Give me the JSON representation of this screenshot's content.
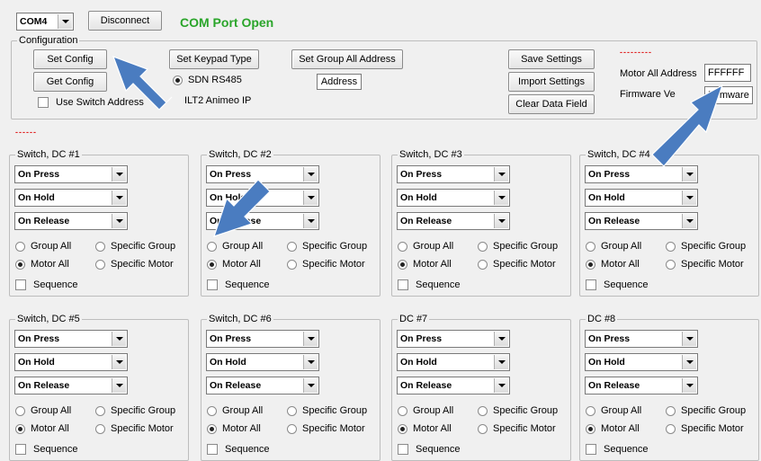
{
  "top": {
    "com_port": "COM4",
    "disconnect_label": "Disconnect",
    "status_text": "COM Port Open"
  },
  "config": {
    "title": "Configuration",
    "set_config_label": "Set Config",
    "get_config_label": "Get Config",
    "use_switch_address_label": "Use Switch Address",
    "set_keypad_type_label": "Set Keypad Type",
    "sdn_rs485_label": "SDN RS485",
    "ilt2_label": "ILT2  Animeo IP",
    "set_group_all_label": "Set Group All Address",
    "address_label": "Address",
    "save_settings_label": "Save Settings",
    "import_settings_label": "Import Settings",
    "clear_data_field_label": "Clear Data Field",
    "red_dashes": "---------",
    "motor_all_address_label": "Motor All Address",
    "motor_all_address_value": "FFFFFF",
    "firmware_version_label": "Firmware Ve",
    "firmware_value": "Firmware"
  },
  "status_dashes": "------",
  "panels": [
    {
      "title": "Switch, DC #1",
      "press": "On Press",
      "hold": "On Hold",
      "release": "On Release",
      "group_all": "Group All",
      "specific_group": "Specific Group",
      "motor_all": "Motor All",
      "specific_motor": "Specific Motor",
      "sequence": "Sequence"
    },
    {
      "title": "Switch, DC #2",
      "press": "On Press",
      "hold": "On Hold",
      "release": "On Release",
      "group_all": "Group All",
      "specific_group": "Specific Group",
      "motor_all": "Motor All",
      "specific_motor": "Specific Motor",
      "sequence": "Sequence"
    },
    {
      "title": "Switch, DC #3",
      "press": "On Press",
      "hold": "On Hold",
      "release": "On Release",
      "group_all": "Group All",
      "specific_group": "Specific Group",
      "motor_all": "Motor All",
      "specific_motor": "Specific Motor",
      "sequence": "Sequence"
    },
    {
      "title": "Switch, DC #4",
      "press": "On Press",
      "hold": "On Hold",
      "release": "On Release",
      "group_all": "Group All",
      "specific_group": "Specific Group",
      "motor_all": "Motor All",
      "specific_motor": "Specific Motor",
      "sequence": "Sequence"
    },
    {
      "title": "Switch, DC #5",
      "press": "On Press",
      "hold": "On Hold",
      "release": "On Release",
      "group_all": "Group All",
      "specific_group": "Specific Group",
      "motor_all": "Motor All",
      "specific_motor": "Specific Motor",
      "sequence": "Sequence"
    },
    {
      "title": "Switch, DC #6",
      "press": "On Press",
      "hold": "On Hold",
      "release": "On Release",
      "group_all": "Group All",
      "specific_group": "Specific Group",
      "motor_all": "Motor All",
      "specific_motor": "Specific Motor",
      "sequence": "Sequence"
    },
    {
      "title": "DC #7",
      "press": "On Press",
      "hold": "On Hold",
      "release": "On Release",
      "group_all": "Group All",
      "specific_group": "Specific Group",
      "motor_all": "Motor All",
      "specific_motor": "Specific Motor",
      "sequence": "Sequence"
    },
    {
      "title": "DC #8",
      "press": "On Press",
      "hold": "On Hold",
      "release": "On Release",
      "group_all": "Group All",
      "specific_group": "Specific Group",
      "motor_all": "Motor All",
      "specific_motor": "Specific Motor",
      "sequence": "Sequence"
    }
  ],
  "colors": {
    "status_green": "#2aa52a",
    "annotation_arrow": "#4a7cc0",
    "red_text": "#e02020"
  }
}
